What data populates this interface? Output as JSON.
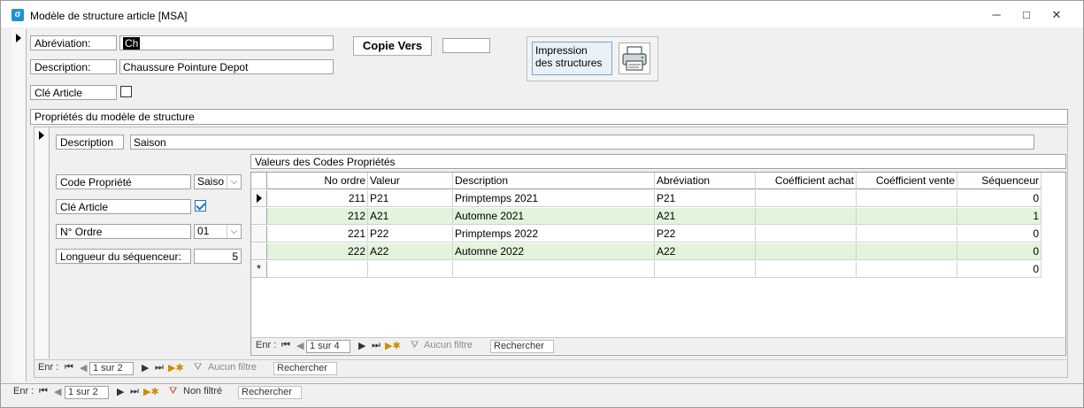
{
  "window": {
    "title": "Modèle de structure article [MSA]",
    "app_icon": "form-icon",
    "controls": [
      "minimize-icon",
      "restore-icon",
      "close-icon"
    ]
  },
  "header": {
    "abbr_label": "Abréviation:",
    "abbr_value": "Ch",
    "desc_label": "Description:",
    "desc_value": "Chaussure Pointure Depot",
    "cle_label": "Clé Article",
    "cle_checked": false,
    "copy_button": "Copie Vers",
    "copy_value": "",
    "print_label_line1": "Impression",
    "print_label_line2": "des structures",
    "print_icon": "printer-icon"
  },
  "properties": {
    "section_title": "Propriétés du modèle de structure",
    "desc_label": "Description",
    "desc_value": "Saison",
    "code_label": "Code Propriété",
    "code_value": "Saiso",
    "cle_label": "Clé Article",
    "cle_checked": true,
    "ordre_label": "N° Ordre",
    "ordre_value": "01",
    "longueur_label": "Longueur du séquenceur:",
    "longueur_value": "5"
  },
  "values_table": {
    "title": "Valeurs des Codes Propriétés",
    "columns": [
      "No ordre",
      "Valeur",
      "Description",
      "Abréviation",
      "Coéfficient achat",
      "Coéfficient vente",
      "Séquenceur"
    ],
    "rows": [
      {
        "no": "211",
        "valeur": "P21",
        "desc": "Primptemps 2021",
        "abbr": "P21",
        "achat": "",
        "vente": "",
        "seq": "0"
      },
      {
        "no": "212",
        "valeur": "A21",
        "desc": "Automne 2021",
        "abbr": "A21",
        "achat": "",
        "vente": "",
        "seq": "1"
      },
      {
        "no": "221",
        "valeur": "P22",
        "desc": "Primptemps 2022",
        "abbr": "P22",
        "achat": "",
        "vente": "",
        "seq": "0"
      },
      {
        "no": "222",
        "valeur": "A22",
        "desc": "Automne 2022",
        "abbr": "A22",
        "achat": "",
        "vente": "",
        "seq": "0"
      }
    ],
    "new_row_marker": "*",
    "new_row_seq": "0"
  },
  "nav_inner": {
    "label": "Enr :",
    "position": "1 sur 4",
    "filter": "Aucun filtre",
    "search": "Rechercher"
  },
  "nav_sub": {
    "label": "Enr :",
    "position": "1 sur 2",
    "filter": "Aucun filtre",
    "search": "Rechercher"
  },
  "nav_main": {
    "label": "Enr :",
    "position": "1 sur 2",
    "filter": "Non filtré",
    "search": "Rechercher"
  },
  "colors": {
    "alt_row": "#e3f4dd",
    "accent": "#1e90d8"
  }
}
